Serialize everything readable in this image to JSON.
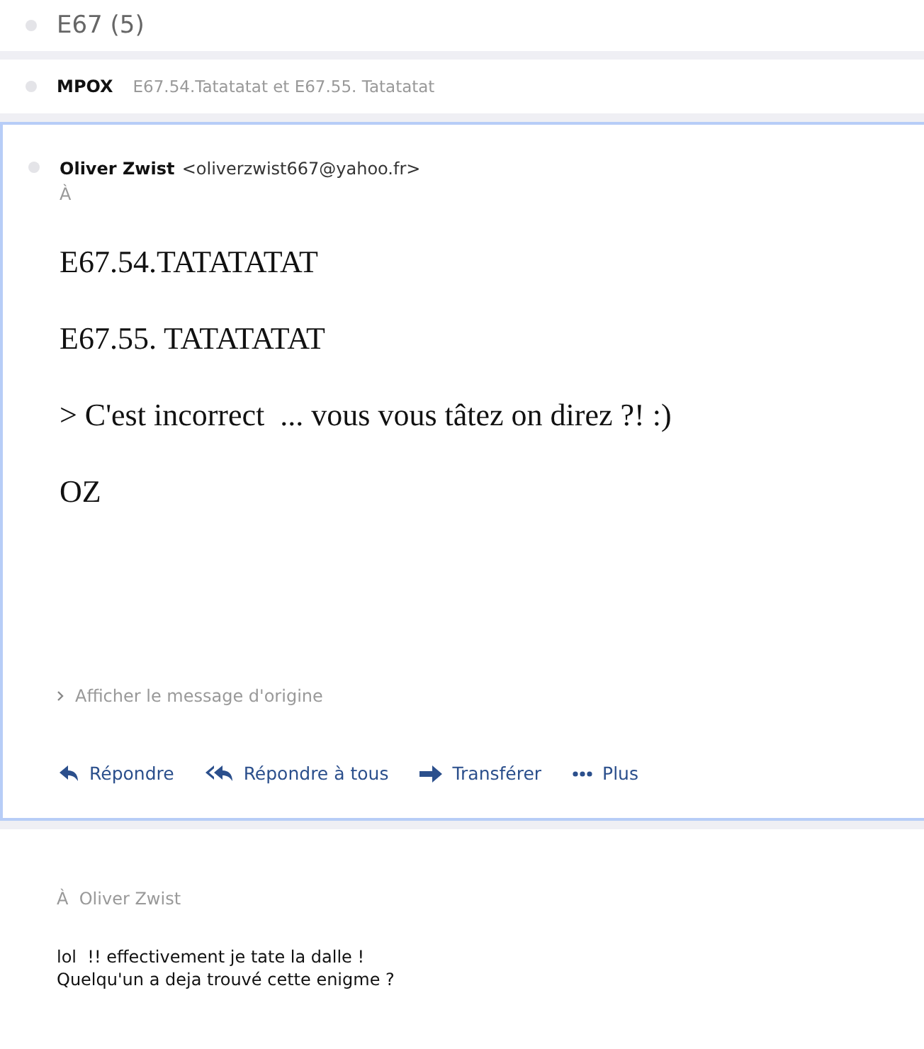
{
  "thread": {
    "title": "E67 (5)"
  },
  "collapsed_message": {
    "sender": "MPOX",
    "preview": "E67.54.Tatatatat et E67.55. Tatatatat"
  },
  "open_message": {
    "sender_name": "Oliver Zwist",
    "sender_email": "<oliverzwist667@yahoo.fr>",
    "to_label": "À",
    "body": [
      "E67.54.TATATATAT",
      "E67.55. TATATATAT",
      "> C'est incorrect  ... vous vous tâtez on direz ?! :)",
      "OZ"
    ],
    "show_original": "Afficher le message d'origine",
    "actions": [
      {
        "kind": "reply",
        "label": "Répondre"
      },
      {
        "kind": "reply-all",
        "label": "Répondre à tous"
      },
      {
        "kind": "forward",
        "label": "Transférer"
      },
      {
        "kind": "more",
        "label": "Plus"
      }
    ]
  },
  "reply": {
    "to_label": "À",
    "recipient": "Oliver Zwist",
    "lines": [
      "lol  !! effectivement je tate la dalle !",
      "Quelqu'un a deja trouvé cette enigme ?"
    ]
  }
}
